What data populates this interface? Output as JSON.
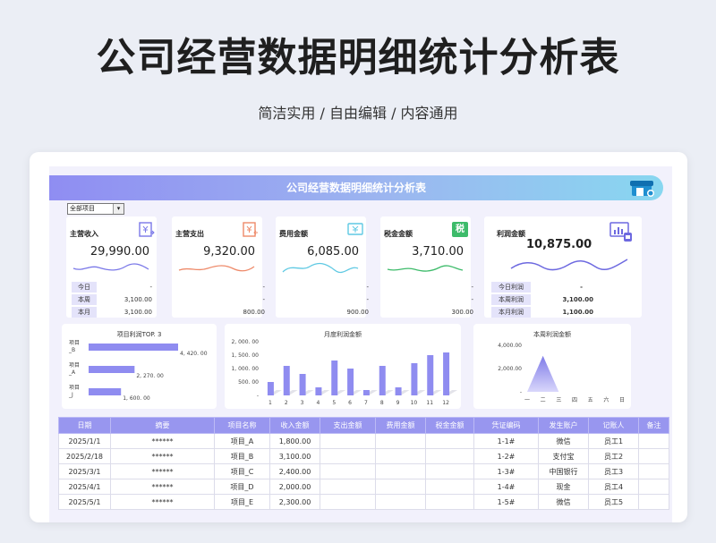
{
  "hero": {
    "title": "公司经营数据明细统计分析表",
    "subtitle": "简洁实用 / 自由编辑 / 内容通用"
  },
  "sheet": {
    "title": "公司经营数据明细统计分析表",
    "filter": {
      "selected": "全部项目",
      "arrow": "▾"
    }
  },
  "cards": [
    {
      "label": "主营收入",
      "value": "29,990.00",
      "icon": "receipt-icon",
      "color": "#7a78e8",
      "rows": [
        {
          "k": "今日",
          "v": "-"
        },
        {
          "k": "本周",
          "v": "3,100.00"
        },
        {
          "k": "本月",
          "v": "3,100.00"
        }
      ]
    },
    {
      "label": "主营支出",
      "value": "9,320.00",
      "icon": "expense-icon",
      "color": "#ee8a6a",
      "rows": [
        {
          "k": "",
          "v": "-"
        },
        {
          "k": "",
          "v": "-"
        },
        {
          "k": "",
          "v": "800.00"
        }
      ]
    },
    {
      "label": "费用金额",
      "value": "6,085.00",
      "icon": "fee-icon",
      "color": "#5fc9e3",
      "rows": [
        {
          "k": "",
          "v": "-"
        },
        {
          "k": "",
          "v": "-"
        },
        {
          "k": "",
          "v": "900.00"
        }
      ]
    },
    {
      "label": "税金金额",
      "value": "3,710.00",
      "icon": "tax-icon",
      "iconText": "税",
      "color": "#3dbb6a",
      "rows": [
        {
          "k": "",
          "v": "-"
        },
        {
          "k": "",
          "v": "-"
        },
        {
          "k": "",
          "v": "300.00"
        }
      ]
    }
  ],
  "profit_card": {
    "label": "利润金额",
    "value": "10,875.00",
    "icon": "profit-chart-icon",
    "color": "#6d69e0",
    "rows": [
      {
        "k": "今日利润",
        "v": "-"
      },
      {
        "k": "本周利润",
        "v": "3,100.00"
      },
      {
        "k": "本月利润",
        "v": "1,100.00"
      }
    ]
  },
  "chart_data": [
    {
      "type": "bar",
      "orientation": "horizontal",
      "title": "项目利润TOP. 3",
      "categories": [
        "项目_B",
        "项目_A",
        "项目_J"
      ],
      "values": [
        4420,
        2270,
        1600
      ],
      "value_labels": [
        "4, 420. 00",
        "2, 270. 00",
        "1, 600. 00"
      ],
      "color": "#8f8cf0"
    },
    {
      "type": "bar",
      "title": "月度利润金额",
      "categories": [
        "1",
        "2",
        "3",
        "4",
        "5",
        "6",
        "7",
        "8",
        "9",
        "10",
        "11",
        "12"
      ],
      "values": [
        500,
        1100,
        800,
        300,
        1300,
        1000,
        200,
        1100,
        300,
        1200,
        1500,
        1600
      ],
      "ylim": [
        0,
        2000
      ],
      "yticks": [
        "2, 000. 00",
        "1, 500. 00",
        "1, 000. 00",
        "500. 00",
        "-"
      ],
      "color": "#8f8cf0"
    },
    {
      "type": "area",
      "title": "本周利润金额",
      "categories": [
        "一",
        "二",
        "三",
        "四",
        "五",
        "六",
        "日"
      ],
      "values": [
        0,
        3100,
        0,
        0,
        0,
        0,
        0
      ],
      "ylim": [
        0,
        4000
      ],
      "yticks": [
        "4,000.00",
        "2,000.00",
        "-"
      ],
      "color": "#8f8cf0"
    }
  ],
  "table": {
    "headers": [
      "日期",
      "摘要",
      "项目名称",
      "收入金额",
      "支出金额",
      "费用金额",
      "税金金额",
      "凭证编码",
      "发生账户",
      "记账人",
      "备注"
    ],
    "rows": [
      [
        "2025/1/1",
        "******",
        "项目_A",
        "1,800.00",
        "",
        "",
        "",
        "1-1#",
        "微信",
        "员工1",
        ""
      ],
      [
        "2025/2/18",
        "******",
        "项目_B",
        "3,100.00",
        "",
        "",
        "",
        "1-2#",
        "支付宝",
        "员工2",
        ""
      ],
      [
        "2025/3/1",
        "******",
        "项目_C",
        "2,400.00",
        "",
        "",
        "",
        "1-3#",
        "中国银行",
        "员工3",
        ""
      ],
      [
        "2025/4/1",
        "******",
        "项目_D",
        "2,000.00",
        "",
        "",
        "",
        "1-4#",
        "现金",
        "员工4",
        ""
      ],
      [
        "2025/5/1",
        "******",
        "项目_E",
        "2,300.00",
        "",
        "",
        "",
        "1-5#",
        "微信",
        "员工5",
        ""
      ]
    ]
  }
}
